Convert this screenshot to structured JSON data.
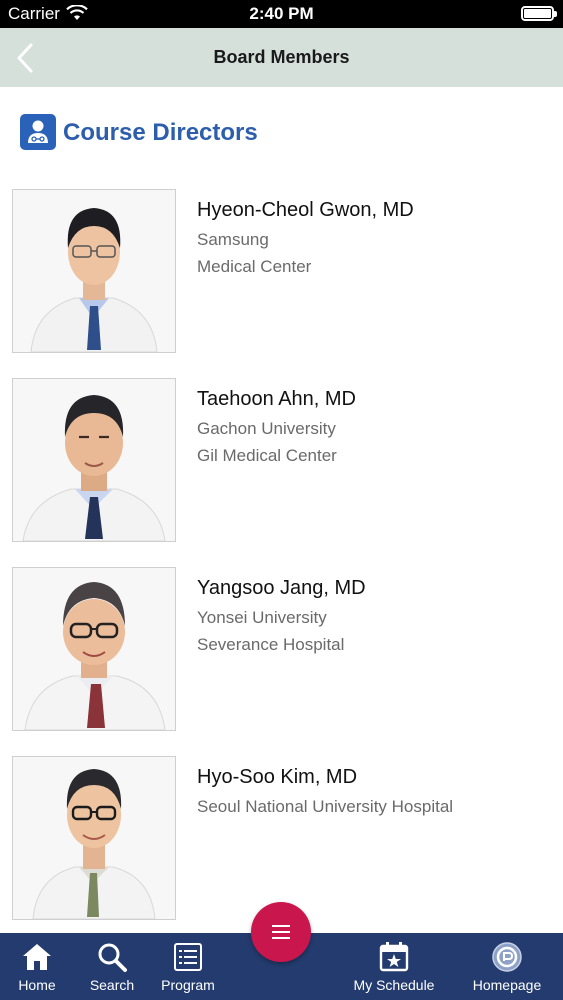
{
  "status_bar": {
    "carrier": "Carrier",
    "time": "2:40 PM",
    "battery_level": 0.92
  },
  "nav": {
    "title": "Board Members",
    "back_icon": "chevron-left-icon"
  },
  "section": {
    "title": "Course Directors",
    "icon": "doctor-badge-icon",
    "accent_color": "#2d5eac"
  },
  "members": [
    {
      "name": "Hyeon-Cheol Gwon, MD",
      "affiliation_line1": "Samsung",
      "affiliation_line2": "Medical Center"
    },
    {
      "name": "Taehoon Ahn, MD",
      "affiliation_line1": "Gachon University",
      "affiliation_line2": "Gil Medical Center"
    },
    {
      "name": "Yangsoo Jang, MD",
      "affiliation_line1": "Yonsei University",
      "affiliation_line2": "Severance Hospital"
    },
    {
      "name": "Hyo-Soo Kim, MD",
      "affiliation_line1": "Seoul National University Hospital",
      "affiliation_line2": ""
    }
  ],
  "fab": {
    "icon": "menu-icon",
    "color": "#c9174d"
  },
  "tab_bar": {
    "background": "#233b6e",
    "tabs": [
      {
        "label": "Home",
        "icon": "home-icon"
      },
      {
        "label": "Search",
        "icon": "search-icon"
      },
      {
        "label": "Program",
        "icon": "list-icon"
      },
      {
        "label": "My Schedule",
        "icon": "calendar-star-icon"
      },
      {
        "label": "Homepage",
        "icon": "globe-logo-icon"
      }
    ]
  }
}
